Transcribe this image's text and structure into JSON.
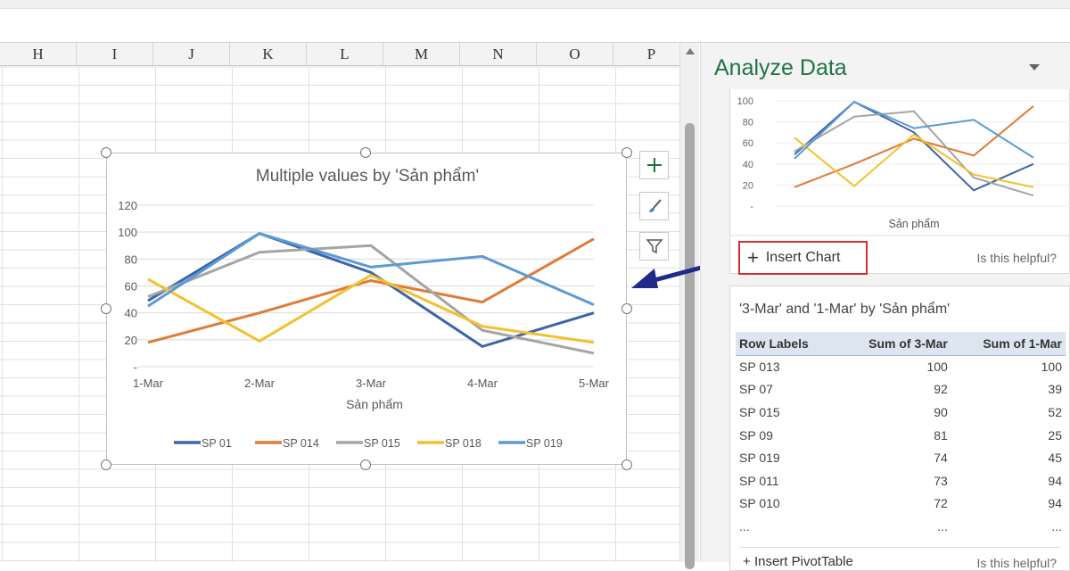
{
  "sheet": {
    "columns": [
      "H",
      "I",
      "J",
      "K",
      "L",
      "M",
      "N",
      "O",
      "P"
    ]
  },
  "chart_data": {
    "type": "line",
    "title": "Multiple values by 'Sản phẩm'",
    "xlabel": "Sản phẩm",
    "ylabel": "",
    "categories": [
      "1-Mar",
      "2-Mar",
      "3-Mar",
      "4-Mar",
      "5-Mar"
    ],
    "ylim": [
      0,
      120
    ],
    "yticks": [
      "-",
      "20",
      "40",
      "60",
      "80",
      "100",
      "120"
    ],
    "grid": true,
    "legend": "bottom",
    "series": [
      {
        "name": "SP 01",
        "color": "#3e64a8",
        "values": [
          49,
          99,
          70,
          15,
          40
        ]
      },
      {
        "name": "SP 014",
        "color": "#e07b39",
        "values": [
          18,
          40,
          64,
          48,
          95
        ]
      },
      {
        "name": "SP 015",
        "color": "#a5a5a5",
        "values": [
          52,
          85,
          90,
          27,
          10
        ]
      },
      {
        "name": "SP 018",
        "color": "#f2c12e",
        "values": [
          65,
          19,
          68,
          30,
          18
        ]
      },
      {
        "name": "SP 019",
        "color": "#5b9bd5",
        "values": [
          45,
          99,
          74,
          82,
          46
        ]
      }
    ]
  },
  "pane": {
    "title": "Analyze Data",
    "card1": {
      "yticks": [
        "-",
        "20",
        "40",
        "60",
        "80",
        "100"
      ],
      "xlabel": "Sản phẩm",
      "insert_label": "Insert Chart",
      "helpful": "Is this helpful?"
    },
    "card2": {
      "title": "'3-Mar' and '1-Mar' by 'Sản phẩm'",
      "headers": [
        "Row Labels",
        "Sum of 3-Mar",
        "Sum of 1-Mar"
      ],
      "rows": [
        [
          "SP 013",
          "100",
          "100"
        ],
        [
          "SP 07",
          "92",
          "39"
        ],
        [
          "SP 015",
          "90",
          "52"
        ],
        [
          "SP 09",
          "81",
          "25"
        ],
        [
          "SP 019",
          "74",
          "45"
        ],
        [
          "SP 011",
          "73",
          "94"
        ],
        [
          "SP 010",
          "72",
          "94"
        ],
        [
          "...",
          "...",
          "..."
        ]
      ],
      "insert_label": "Insert PivotTable",
      "helpful": "Is this helpful?"
    }
  }
}
